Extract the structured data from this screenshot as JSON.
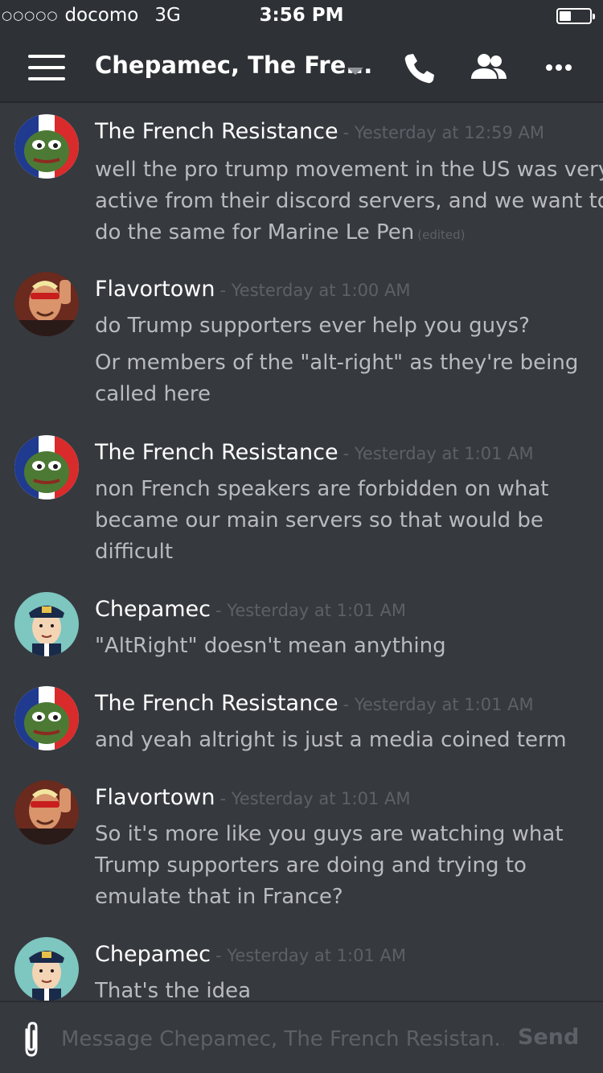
{
  "status_bar": {
    "signal": "○○○○○",
    "carrier": "docomo",
    "network": "3G",
    "time": "3:56 PM",
    "battery_level": 0.4
  },
  "nav": {
    "title": "Chepamec, The Fre...",
    "icons": [
      "menu-icon",
      "chevron-down-icon",
      "phone-icon",
      "members-icon",
      "more-icon"
    ]
  },
  "messages": [
    {
      "author": "The French Resistance",
      "timestamp": "- Yesterday at 12:59 AM",
      "avatar": "pepe-avatar",
      "lines": [
        "well the pro trump movement in the US was very",
        "active from their discord servers, and we want to",
        "do the same for Marine Le Pen"
      ],
      "edited": "(edited)"
    },
    {
      "author": "Flavortown",
      "timestamp": "- Yesterday at 1:00 AM",
      "avatar": "flavortown-avatar",
      "lines": [
        "do Trump supporters ever help you guys?",
        "Or members of the \"alt-right\" as they're being",
        "called here"
      ]
    },
    {
      "author": "The French Resistance",
      "timestamp": "- Yesterday at 1:01 AM",
      "avatar": "pepe-avatar",
      "lines": [
        "non French speakers are forbidden on what",
        "became our main servers so that would be",
        "difficult"
      ]
    },
    {
      "author": "Chepamec",
      "timestamp": "- Yesterday at 1:01 AM",
      "avatar": "captain-avatar",
      "lines": [
        "\"AltRight\" doesn't mean anything"
      ]
    },
    {
      "author": "The French Resistance",
      "timestamp": "- Yesterday at 1:01 AM",
      "avatar": "pepe-avatar",
      "lines": [
        "and yeah altright is just a media coined term"
      ]
    },
    {
      "author": "Flavortown",
      "timestamp": "- Yesterday at 1:01 AM",
      "avatar": "flavortown-avatar",
      "lines": [
        "So it's more like you guys are watching what",
        "Trump supporters are doing and trying to",
        "emulate that in France?"
      ]
    },
    {
      "author": "Chepamec",
      "timestamp": "- Yesterday at 1:01 AM",
      "avatar": "captain-avatar",
      "lines": [
        "That's the idea"
      ]
    }
  ],
  "composer": {
    "placeholder": "Message Chepamec, The French Resistan...",
    "send_label": "Send"
  },
  "colors": {
    "background": "#36393e",
    "topbar": "#2e3136",
    "author": "#ffffff",
    "message_text": "#b9bbbe",
    "timestamp": "#5d6167"
  }
}
